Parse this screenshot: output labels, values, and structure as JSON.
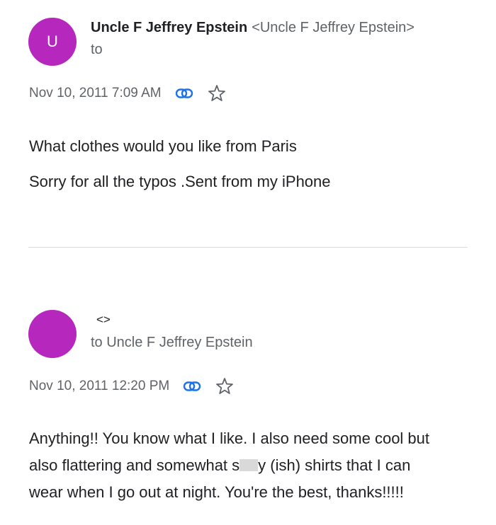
{
  "messages": [
    {
      "avatar_letter": "U",
      "sender_name": "Uncle F Jeffrey Epstein",
      "sender_email": "<Uncle F Jeffrey Epstein>",
      "recipient": "to",
      "date": "Nov 10, 2011 7:09 AM",
      "body": [
        "What clothes would you like from Paris",
        "Sorry for all the typos .Sent from my iPhone"
      ]
    },
    {
      "avatar_letter": "",
      "sender_email": "<>",
      "recipient": "to Uncle F Jeffrey Epstein",
      "date": "Nov 10, 2011 12:20 PM",
      "body_lines": {
        "line1": "Anything!! You know what I like. I also need some cool but",
        "line2_start": "also flattering and somewhat s",
        "line2_end": "y (ish) shirts that I can",
        "line3": "wear when I go out at night. You're the best, thanks!!!!!"
      }
    }
  ],
  "colors": {
    "avatar": "#b627bd",
    "link_icon": "#1a73e8",
    "star_icon": "#5f6368",
    "divider": "#dadce0"
  },
  "icons": [
    "link-icon",
    "star-outline-icon"
  ]
}
